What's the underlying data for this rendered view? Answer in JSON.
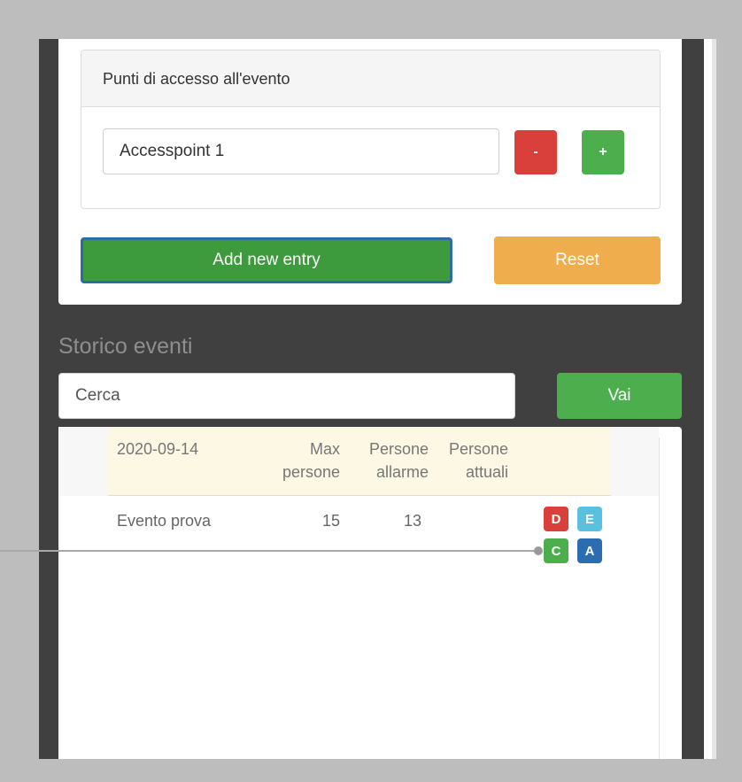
{
  "access_points": {
    "heading": "Punti di accesso all'evento",
    "input_value": "Accesspoint 1",
    "remove_label": "-",
    "add_label": "+"
  },
  "form_actions": {
    "add_entry_label": "Add new entry",
    "reset_label": "Reset"
  },
  "history": {
    "title": "Storico eventi",
    "search_placeholder": "Cerca",
    "go_label": "Vai",
    "table": {
      "columns": [
        "2020-09-14",
        "Max\npersone",
        "Persone\nallarme",
        "Persone\nattuali"
      ],
      "rows": [
        {
          "name": "Evento prova",
          "max_persone": "15",
          "persone_allarme": "13",
          "persone_attuali": "",
          "actions": [
            "D",
            "E",
            "C",
            "A"
          ]
        }
      ]
    }
  },
  "colors": {
    "danger": "#d9403c",
    "success": "#4cae4c",
    "info": "#5bc0de",
    "primary": "#2c6cb0",
    "warning": "#f0ad4e"
  }
}
